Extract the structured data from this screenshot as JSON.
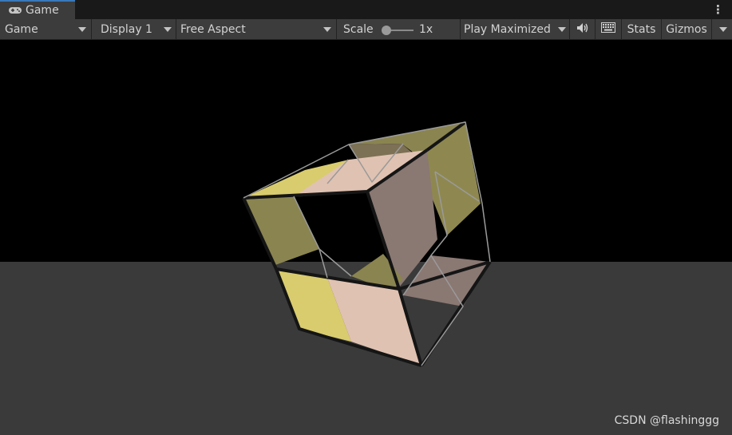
{
  "window": {
    "tab_title": "Game",
    "tab_icon": "gamepad-icon",
    "menu_icon": "kebab-menu-icon"
  },
  "toolbar": {
    "view_mode": "Game",
    "display": "Display 1",
    "aspect": "Free Aspect",
    "scale_label": "Scale",
    "scale_value": "1x",
    "play_mode": "Play Maximized",
    "audio_icon": "speaker-icon",
    "keyboard_icon": "keyboard-icon",
    "stats_label": "Stats",
    "gizmos_label": "Gizmos"
  },
  "scene": {
    "sky_color": "#000000",
    "ground_color": "#3a3a3a",
    "face_colors": {
      "yellow": "#d9cc6e",
      "olive": "#8a8450",
      "pink": "#e0c2b2",
      "mauve": "#8a7873"
    }
  },
  "watermark": "CSDN @flashinggg"
}
